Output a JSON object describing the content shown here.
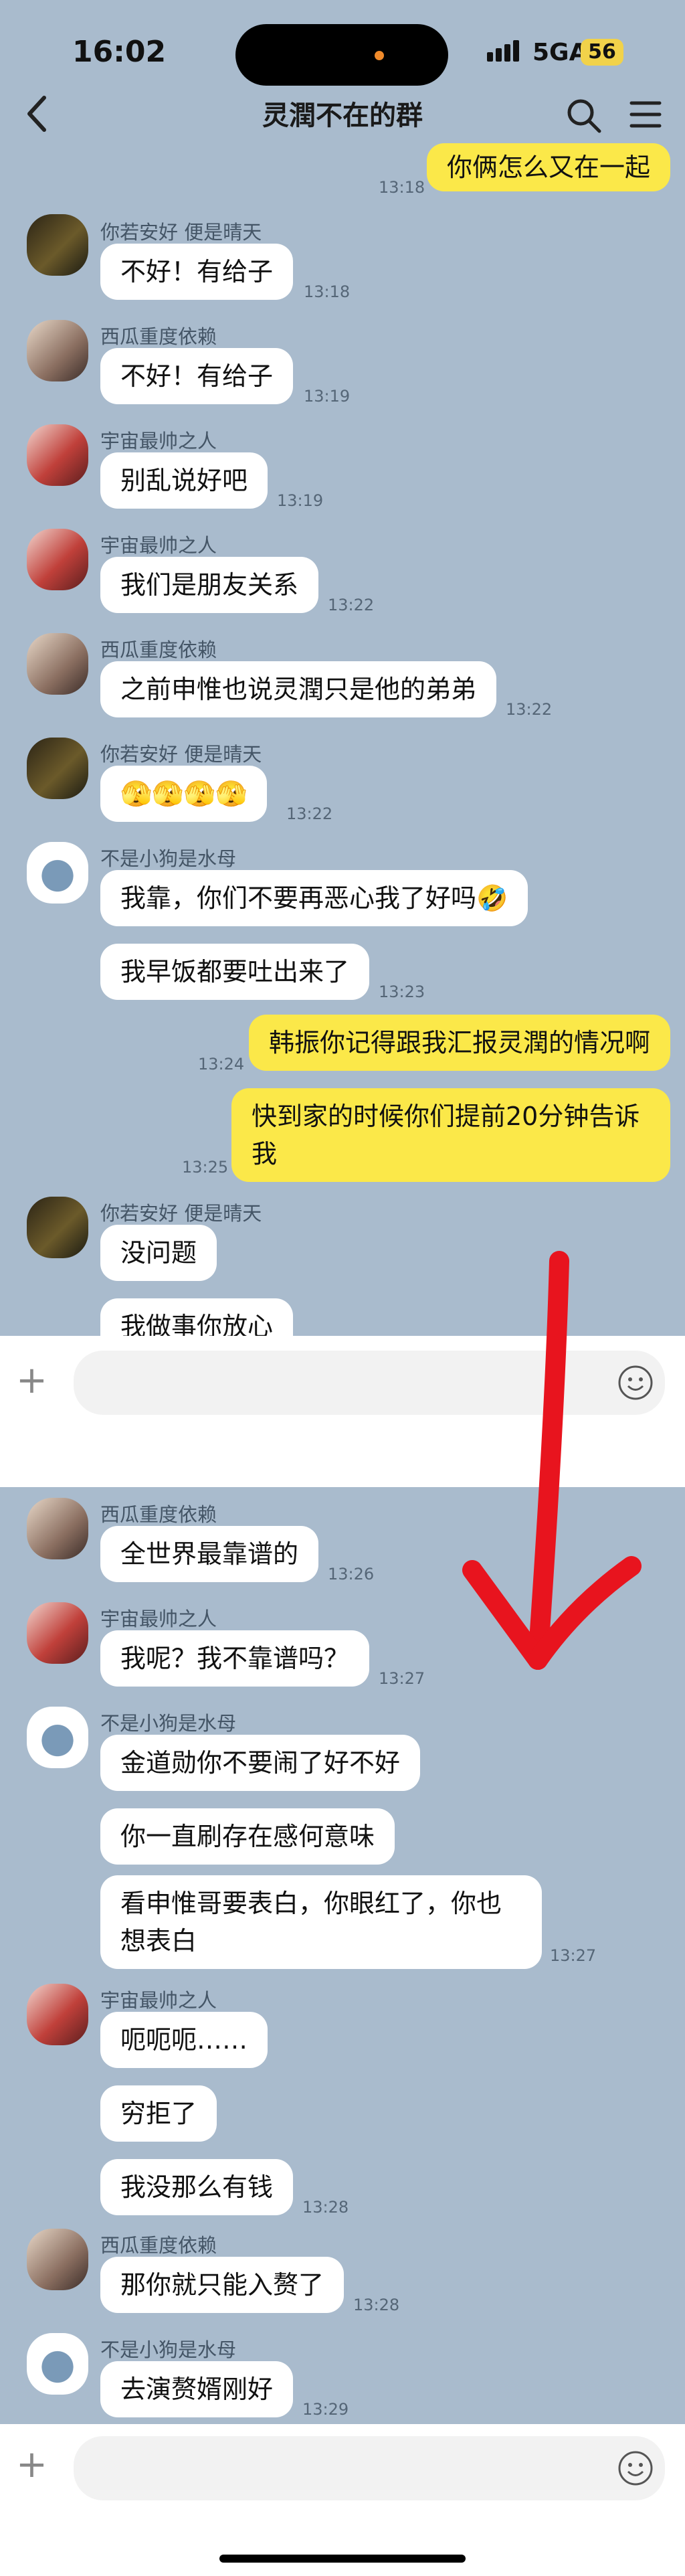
{
  "status": {
    "time": "16:02",
    "network": "5GA",
    "battery": "56"
  },
  "header": {
    "title": "灵潤不在的群",
    "back_icon": "chevron-left-icon",
    "search_icon": "search-icon",
    "menu_icon": "hamburger-menu-icon"
  },
  "senders": {
    "a": "你若安好 便是晴天",
    "b": "西瓜重度依赖",
    "c": "宇宙最帅之人",
    "d": "不是小狗是水母"
  },
  "screen1": {
    "m0": {
      "text": "你俩怎么又在一起",
      "time": "13:18"
    },
    "m1": {
      "text": "不好！有给子",
      "time": "13:18"
    },
    "m2": {
      "text": "不好！有给子",
      "time": "13:19"
    },
    "m3": {
      "text": "别乱说好吧",
      "time": "13:19"
    },
    "m4": {
      "text": "我们是朋友关系",
      "time": "13:22"
    },
    "m5": {
      "text": "之前申惟也说灵潤只是他的弟弟",
      "time": "13:22"
    },
    "m6": {
      "text": "🫣🫣🫣🫣",
      "time": "13:22"
    },
    "m7": {
      "text": "我靠，你们不要再恶心我了好吗🤣"
    },
    "m8": {
      "text": "我早饭都要吐出来了",
      "time": "13:23"
    },
    "m9": {
      "text": "韩振你记得跟我汇报灵潤的情况啊",
      "time": "13:24"
    },
    "m10": {
      "text": "快到家的时候你们提前20分钟告诉\n我",
      "time": "13:25"
    },
    "m11": {
      "text": "没问题"
    },
    "m12": {
      "text": "我做事你放心"
    }
  },
  "screen2": {
    "m1": {
      "text": "全世界最靠谱的",
      "time": "13:26"
    },
    "m2": {
      "text": "我呢？我不靠谱吗？",
      "time": "13:27"
    },
    "m3": {
      "text": "金道勋你不要闹了好不好"
    },
    "m4": {
      "text": "你一直刷存在感何意味"
    },
    "m5": {
      "text": "看申惟哥要表白，你眼红了，你也\n想表白",
      "time": "13:27"
    },
    "m6": {
      "text": "呃呃呃……"
    },
    "m7": {
      "text": "穷拒了"
    },
    "m8": {
      "text": "我没那么有钱",
      "time": "13:28"
    },
    "m9": {
      "text": "那你就只能入赘了",
      "time": "13:28"
    },
    "m10": {
      "text": "去演赘婿刚好",
      "time": "13:29"
    }
  },
  "input": {
    "plus_icon": "plus-icon",
    "emoji_icon": "smiley-icon",
    "value": ""
  },
  "annotation": {
    "color": "#e8141e",
    "shape": "hand-drawn-down-arrow"
  }
}
